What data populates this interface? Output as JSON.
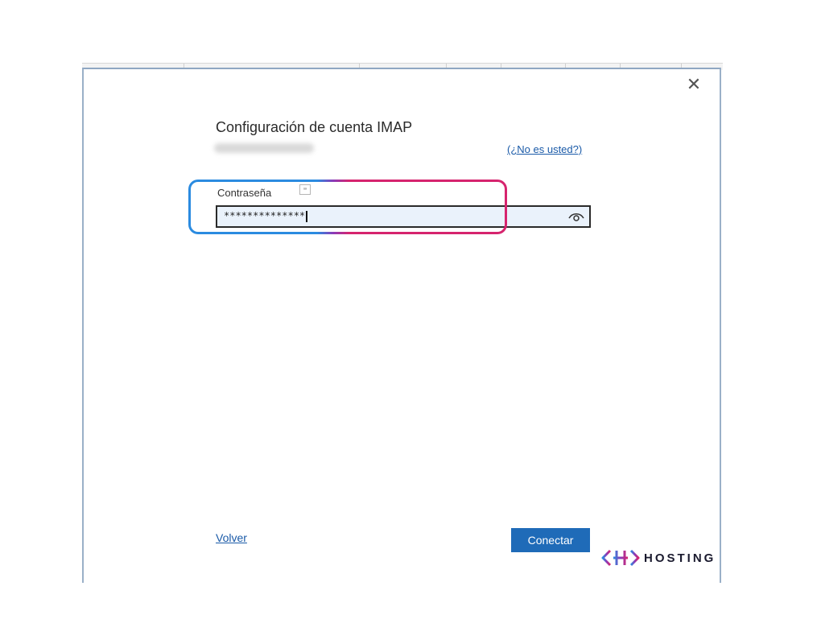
{
  "dialog": {
    "title": "Configuración de cuenta IMAP",
    "not_you_link": "(¿No es usted?)",
    "password_label": "Contraseña",
    "password_value": "**************",
    "keyboard_icon": "keyboard-icon",
    "eye_icon": "eye-icon",
    "close_icon": "close-icon",
    "back_link": "Volver",
    "connect_button": "Conectar"
  },
  "brand": {
    "logo_text": "HOSTING",
    "colors": {
      "primary": "#1f6bb8",
      "link": "#1a5aa8",
      "highlight_blue": "#2b8be0",
      "highlight_pink": "#d6246e"
    }
  }
}
